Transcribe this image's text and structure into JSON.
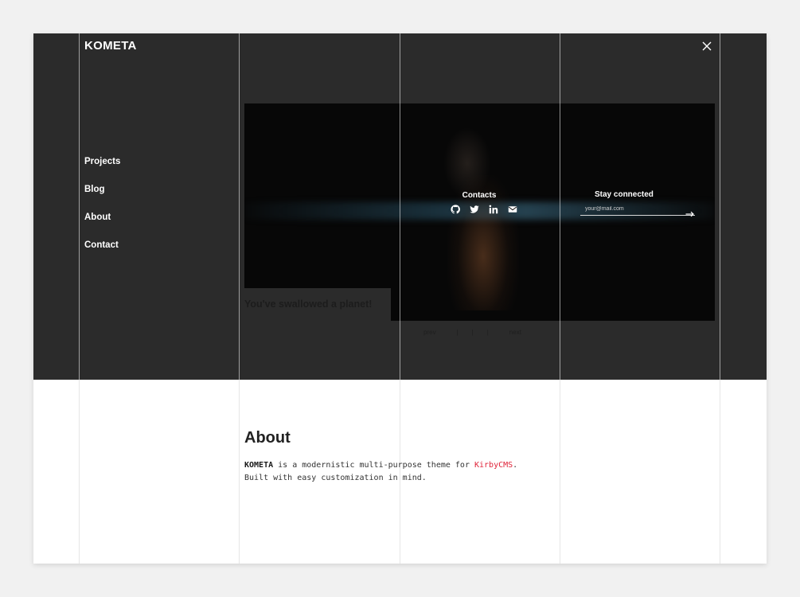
{
  "brand": {
    "logo": "KOMETA"
  },
  "header": {
    "close_icon": "close-icon"
  },
  "nav": {
    "items": [
      "Projects",
      "Blog",
      "About",
      "Contact"
    ]
  },
  "hero": {
    "title": "You've swallowed a planet!",
    "contacts_title": "Contacts",
    "social_icons": [
      "github-icon",
      "twitter-icon",
      "linkedin-icon",
      "envelope-icon"
    ],
    "newsletter": {
      "title": "Stay connected",
      "placeholder": "your@mail.com",
      "submit_icon": "arrow-right-icon"
    },
    "pager": {
      "prev": "prev",
      "separator": "|",
      "next": "next"
    }
  },
  "about": {
    "title": "About",
    "brand": "KOMETA",
    "line1_mid": " is a modernistic multi-purpose theme for ",
    "link": "KirbyCMS",
    "line1_end": ".",
    "line2": "Built with easy customization in mind."
  },
  "colors": {
    "dark_bg": "#2b2b2b",
    "page_bg": "#f1f1f1",
    "accent": "#e0243a",
    "text": "#222222"
  }
}
